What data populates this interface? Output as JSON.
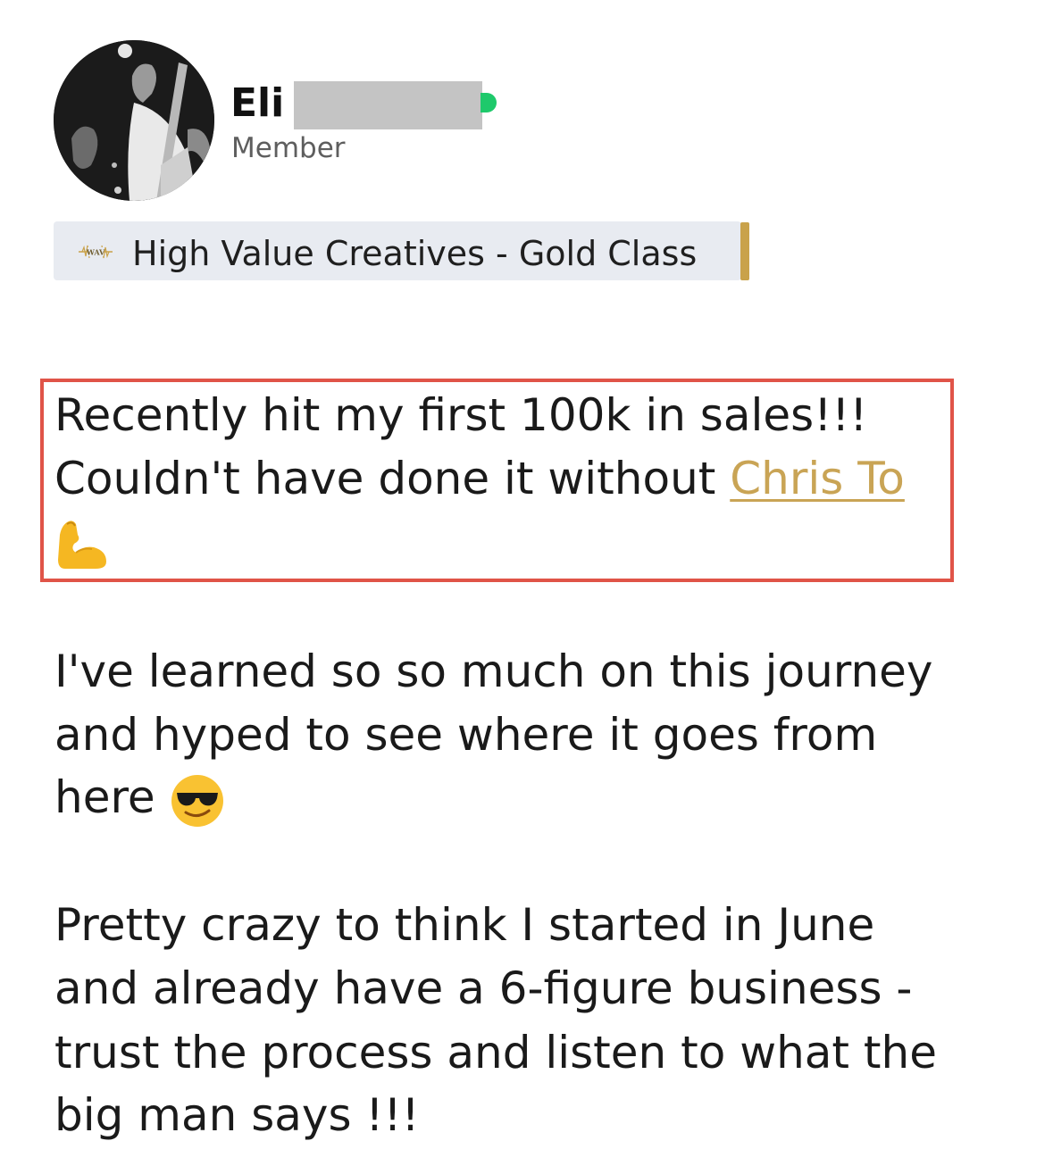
{
  "author": {
    "name": "Eli",
    "role": "Member",
    "online": true,
    "avatar_icon": "profile-photo-guitarist",
    "status_color": "#1ec96b"
  },
  "group_badge": {
    "icon": "wav-logo-icon",
    "icon_text": "WAV",
    "label": "High Value Creatives - Gold Class",
    "accent_color": "#c9a24a"
  },
  "post": {
    "highlight_color": "#e05448",
    "mention_color": "#c9a455",
    "highlighted": {
      "line1": "Recently hit my first 100k in sales!!!",
      "line2_prefix": "Couldn't have done it without ",
      "mention": "Chris To",
      "emoji": "flexed-biceps-emoji"
    },
    "paragraph2": {
      "line1": "I've learned so so much on this journey",
      "line2": "and hyped to see where it goes from",
      "line3": "here",
      "emoji": "sunglasses-face-emoji"
    },
    "paragraph3": {
      "line1": "Pretty crazy to think I started in June",
      "line2": "and already have a 6-figure business -",
      "line3": "trust the process and listen to what the",
      "line4": "big man says !!!"
    }
  }
}
